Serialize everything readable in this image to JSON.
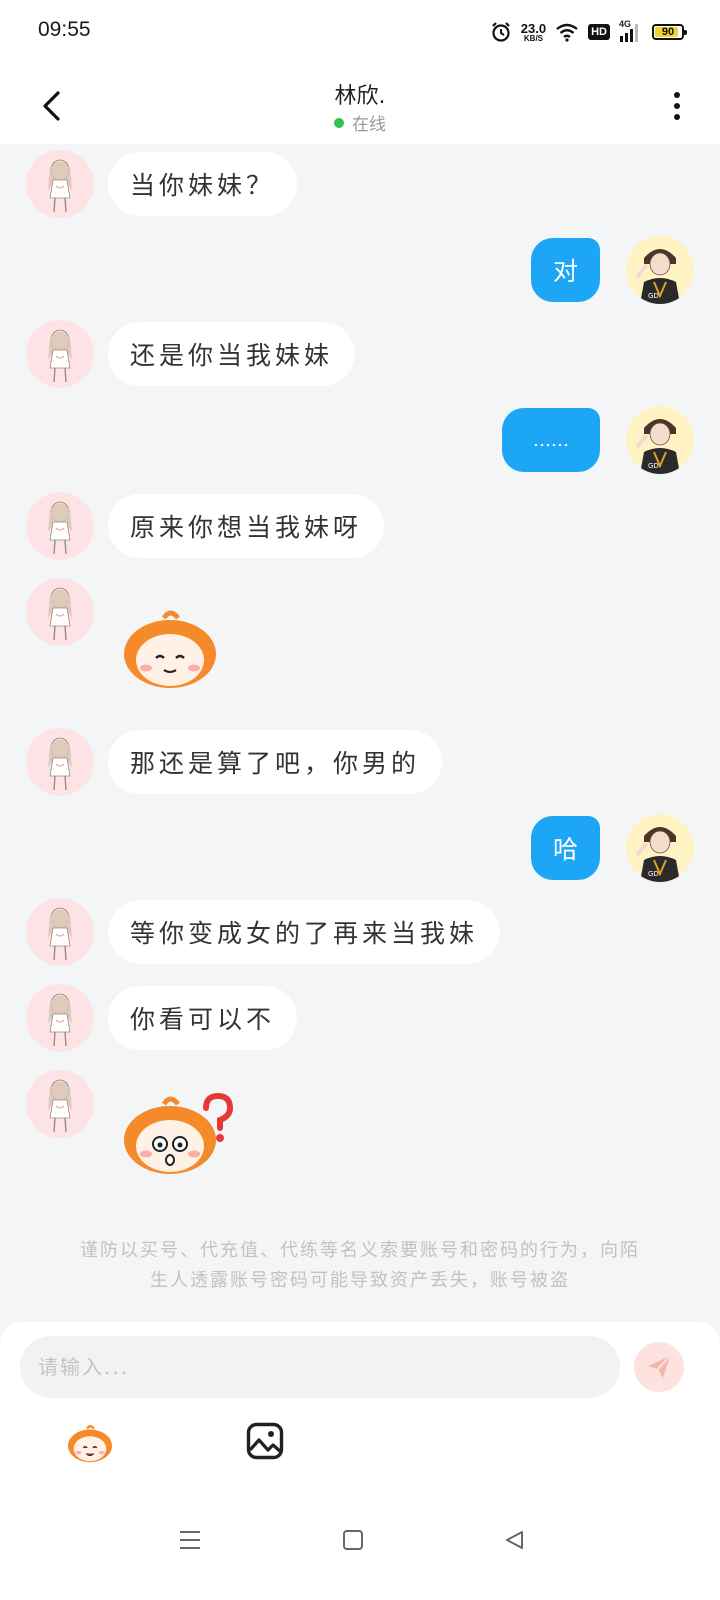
{
  "status_bar": {
    "time": "09:55",
    "net_speed": "23.0",
    "net_unit": "KB/S",
    "hd_label": "HD",
    "network_type": "4G",
    "battery_level": "90",
    "battery_fraction": 0.9,
    "icons": [
      "alarm-icon",
      "wifi-icon",
      "signal-icon",
      "battery-icon"
    ]
  },
  "header": {
    "title": "林欣.",
    "status": "在线",
    "status_color": "#2ec24e",
    "back_icon": "chevron-left-icon",
    "more_icon": "more-vertical-icon"
  },
  "messages": [
    {
      "side": "in",
      "text": "当你妹妹？"
    },
    {
      "side": "out",
      "text": "对"
    },
    {
      "side": "in",
      "text": "还是你当我妹妹"
    },
    {
      "side": "out",
      "text": "……"
    },
    {
      "side": "in",
      "text": "原来你想当我妹呀"
    },
    {
      "side": "in",
      "sticker": "smile-sticker"
    },
    {
      "side": "in",
      "text": "那还是算了吧，你男的"
    },
    {
      "side": "out",
      "text": "哈"
    },
    {
      "side": "in",
      "text": "等你变成女的了再来当我妹"
    },
    {
      "side": "in",
      "text": "你看可以不"
    },
    {
      "side": "in",
      "sticker": "question-sticker"
    }
  ],
  "warning": {
    "line1": "谨防以买号、代充值、代练等名义索要账号和密码的行为，向陌",
    "line2": "生人透露账号密码可能导致资产丢失，账号被盗"
  },
  "composer": {
    "placeholder": "请输入...",
    "value": "",
    "send_icon": "send-icon",
    "tools": [
      "emoji-icon",
      "image-icon"
    ]
  },
  "colors": {
    "accent": "#1da6f5",
    "background": "#f4f5f7",
    "bubble_in": "#ffffff"
  },
  "nav": [
    "menu-icon",
    "home-icon",
    "back-triangle-icon"
  ]
}
